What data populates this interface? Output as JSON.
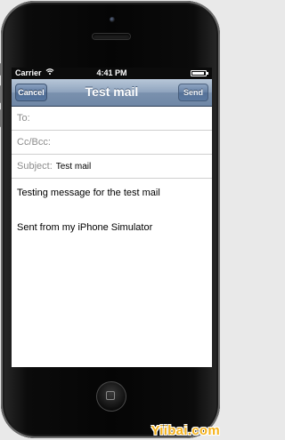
{
  "status_bar": {
    "carrier": "Carrier",
    "wifi_icon": "wifi-icon",
    "time": "4:41 PM",
    "battery_icon": "battery-icon",
    "battery_level": 0.9
  },
  "nav_bar": {
    "cancel_label": "Cancel",
    "title": "Test mail",
    "send_label": "Send"
  },
  "fields": {
    "to_label": "To:",
    "to_value": "",
    "cc_label": "Cc/Bcc:",
    "cc_value": "",
    "subject_label": "Subject:",
    "subject_value": "Test mail"
  },
  "message": {
    "body": "Testing message for the test mail",
    "signature": "Sent from my iPhone Simulator"
  },
  "watermark": "Yiibai.com",
  "colors": {
    "nav_bar": "#7a91ae",
    "watermark": "#f5b21b"
  }
}
